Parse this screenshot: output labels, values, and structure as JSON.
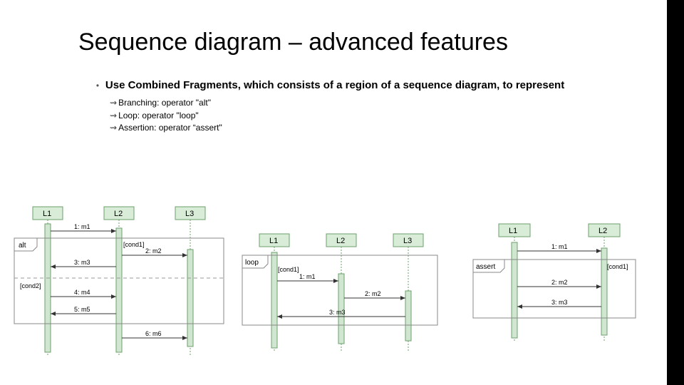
{
  "title": "Sequence diagram – advanced features",
  "bullet": "Use Combined Fragments, which consists of a region of a sequence diagram, to represent",
  "subs": {
    "s1": "Branching: operator \"alt\"",
    "s2": "Loop: operator \"loop\"",
    "s3": "Assertion: operator “assert\""
  },
  "d1": {
    "L1": "L1",
    "L2": "L2",
    "L3": "L3",
    "op": "alt",
    "guard1": "[cond1]",
    "guard2": "[cond2]",
    "m1": "1: m1",
    "m2": "2: m2",
    "m3": "3: m3",
    "m4": "4: m4",
    "m5": "5: m5",
    "m6": "6: m6"
  },
  "d2": {
    "L1": "L1",
    "L2": "L2",
    "L3": "L3",
    "op": "loop",
    "guard": "[cond1]",
    "m1": "1: m1",
    "m2": "2: m2",
    "m3": "3: m3"
  },
  "d3": {
    "L1": "L1",
    "L2": "L2",
    "op": "assert",
    "guard": "[cond1]",
    "m1": "1: m1",
    "m2": "2: m2",
    "m3": "3: m3"
  }
}
